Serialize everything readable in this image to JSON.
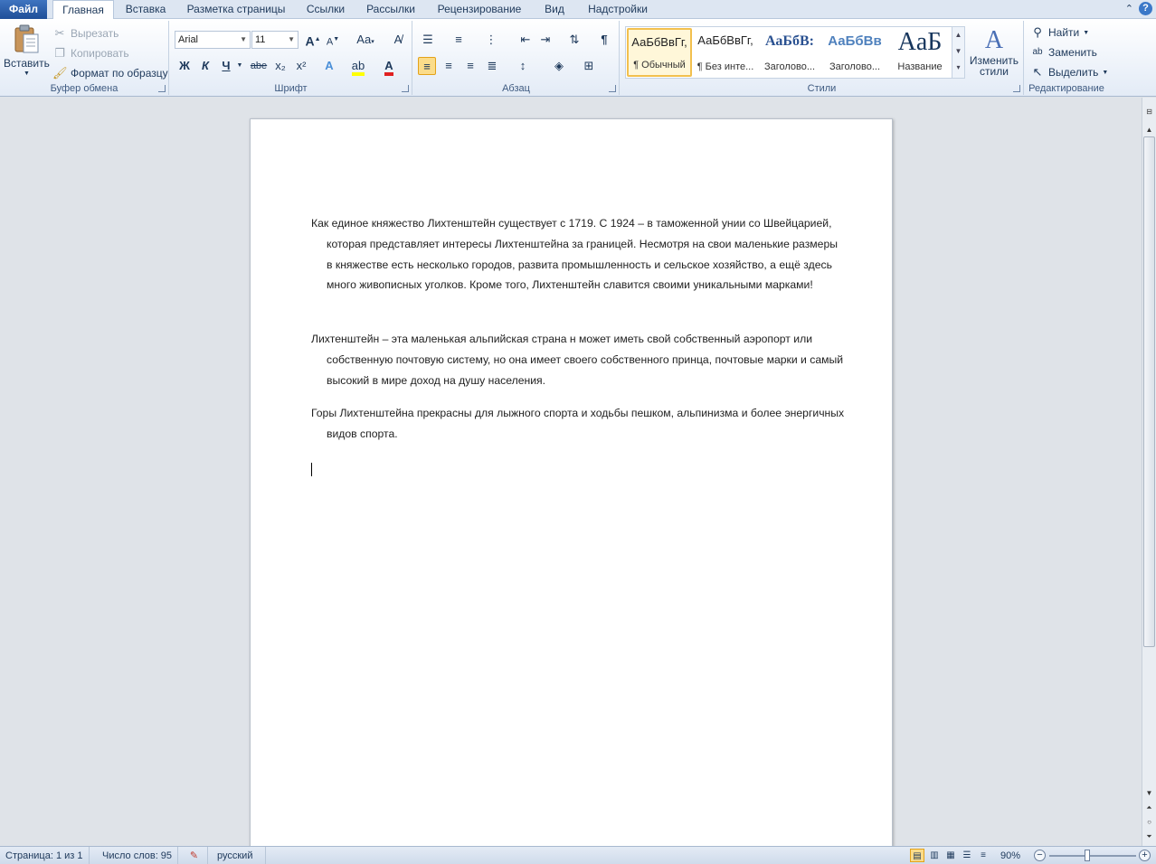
{
  "tabs": {
    "file": "Файл",
    "home": "Главная",
    "insert": "Вставка",
    "layout": "Разметка страницы",
    "references": "Ссылки",
    "mailings": "Рассылки",
    "review": "Рецензирование",
    "view": "Вид",
    "addins": "Надстройки"
  },
  "clipboard": {
    "paste": "Вставить",
    "cut": "Вырезать",
    "copy": "Копировать",
    "format_painter": "Формат по образцу",
    "label": "Буфер обмена"
  },
  "font": {
    "name": "Arial",
    "size": "11",
    "grow": "A",
    "shrink": "A",
    "change_case": "Aa",
    "bold": "Ж",
    "italic": "К",
    "underline": "Ч",
    "strike": "abe",
    "subscript": "x₂",
    "superscript": "x²",
    "label": "Шрифт"
  },
  "paragraph": {
    "label": "Абзац"
  },
  "styles": {
    "items": [
      {
        "preview": "АаБбВвГг,",
        "name": "¶ Обычный"
      },
      {
        "preview": "АаБбВвГг,",
        "name": "¶ Без инте..."
      },
      {
        "preview": "АаБбВ:",
        "name": "Заголово..."
      },
      {
        "preview": "АаБбВв",
        "name": "Заголово..."
      },
      {
        "preview": "AaБ",
        "name": "Название"
      }
    ],
    "change": "Изменить стили",
    "label": "Стили"
  },
  "editing": {
    "find": "Найти",
    "replace": "Заменить",
    "select": "Выделить",
    "label": "Редактирование"
  },
  "document": {
    "paragraphs": [
      "Как единое княжество Лихтенштейн существует с 1719.  С 1924 – в таможенной унии со Швейцарией, которая представляет интересы Лихтенштейна за границей. Несмотря на свои маленькие размеры в княжестве есть несколько городов, развита промышленность и сельское хозяйство, а ещё здесь много живописных уголков. Кроме того, Лихтенштейн славится своими уникальными марками!",
      "Лихтенштейн – эта маленькая альпийская страна н может иметь свой собственный аэропорт или собственную почтовую систему, но она имеет своего собственного принца, почтовые марки и самый высокий в мире доход на душу населения.",
      "Горы Лихтенштейна прекрасны для лыжного спорта и ходьбы пешком, альпинизма и более энергичных видов спорта."
    ]
  },
  "status": {
    "page": "Страница: 1 из 1",
    "words": "Число слов: 95",
    "language": "русский",
    "zoom": "90%",
    "zoom_level_percent": 90
  }
}
